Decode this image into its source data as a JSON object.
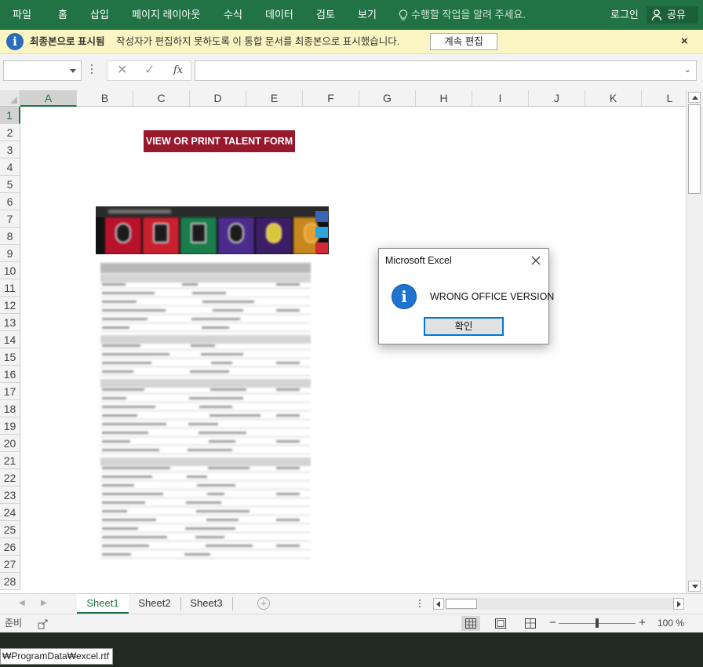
{
  "ribbon": {
    "tabs": [
      "파일",
      "홈",
      "삽입",
      "페이지 레이아웃",
      "수식",
      "데이터",
      "검토",
      "보기"
    ],
    "tell_me_placeholder": "수행할 작업을 알려 주세요.",
    "login_label": "로그인",
    "share_label": "공유"
  },
  "message_bar": {
    "title": "최종본으로 표시됨",
    "text": "작성자가 편집하지 못하도록 이 통합 문서를 최종본으로 표시했습니다.",
    "button_label": "계속 편집",
    "close_glyph": "×"
  },
  "formula_bar": {
    "name_box_value": "",
    "cancel_glyph": "✕",
    "enter_glyph": "✓",
    "fx_label": "fx",
    "formula_value": ""
  },
  "grid": {
    "selected_column": "A",
    "selected_row": "1",
    "columns": [
      "A",
      "B",
      "C",
      "D",
      "E",
      "F",
      "G",
      "H",
      "I",
      "J",
      "K",
      "L"
    ],
    "rows": [
      "1",
      "2",
      "3",
      "4",
      "5",
      "6",
      "7",
      "8",
      "9",
      "10",
      "11",
      "12",
      "13",
      "14",
      "15",
      "16",
      "17",
      "18",
      "19",
      "20",
      "21",
      "22",
      "23",
      "24",
      "25",
      "26",
      "27",
      "28"
    ]
  },
  "sheet": {
    "banner_label": "VIEW OR PRINT TALENT FORM"
  },
  "sheet_tabs": {
    "tabs": [
      "Sheet1",
      "Sheet2",
      "Sheet3"
    ],
    "active": "Sheet1",
    "add_glyph": "+"
  },
  "status_bar": {
    "ready_label": "준비",
    "zoom_label": "100 %",
    "zoom_minus": "−",
    "zoom_plus": "+"
  },
  "dialog": {
    "title": "Microsoft Excel",
    "message": "WRONG OFFICE VERSION",
    "ok_label": "확인",
    "icon_glyph": "i"
  },
  "taskbar": {
    "path_text": "₩ProgramData₩excel.rtf"
  },
  "colors": {
    "ribbon_green": "#217346",
    "message_bar_yellow": "#fbf5c3",
    "banner_red": "#97192e",
    "dialog_info_blue": "#1f73d0",
    "dialog_button_border": "#0078d7"
  },
  "icons": {
    "tell_me": "lightbulb-icon",
    "share": "person-icon",
    "message_bar": "info-icon",
    "dialog": "info-icon",
    "dialog_close": "close-icon"
  }
}
